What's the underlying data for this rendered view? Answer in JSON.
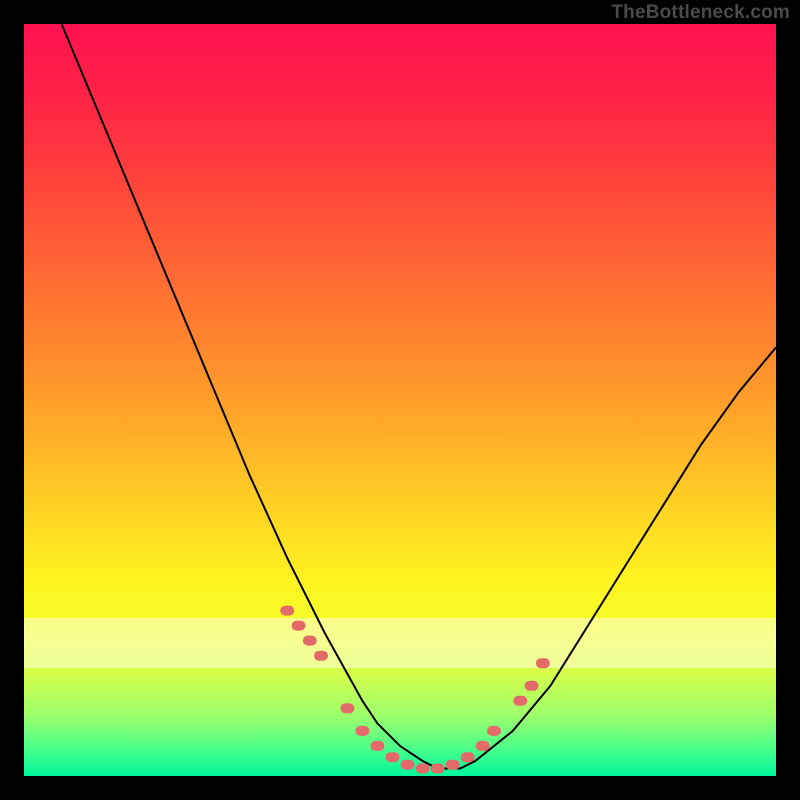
{
  "watermark": "TheBottleneck.com",
  "chart_data": {
    "type": "line",
    "title": "",
    "xlabel": "",
    "ylabel": "",
    "xlim": [
      0,
      100
    ],
    "ylim": [
      0,
      100
    ],
    "grid": false,
    "legend": false,
    "series": [
      {
        "name": "bottleneck-curve",
        "x": [
          5,
          10,
          15,
          20,
          25,
          30,
          35,
          40,
          45,
          47,
          50,
          53,
          55,
          58,
          60,
          65,
          70,
          75,
          80,
          85,
          90,
          95,
          100
        ],
        "y": [
          100,
          88,
          76,
          64,
          52,
          40,
          29,
          19,
          10,
          7,
          4,
          2,
          1,
          1,
          2,
          6,
          12,
          20,
          28,
          36,
          44,
          51,
          57
        ]
      }
    ],
    "marker_band": {
      "name": "highlighted-points",
      "x": [
        35,
        36.5,
        38,
        39.5,
        43,
        45,
        47,
        49,
        51,
        53,
        55,
        57,
        59,
        61,
        62.5,
        66,
        67.5,
        69
      ],
      "y": [
        22,
        20,
        18,
        16,
        9,
        6,
        4,
        2.5,
        1.5,
        1,
        1,
        1.5,
        2.5,
        4,
        6,
        10,
        12,
        15
      ]
    },
    "annotations": []
  }
}
